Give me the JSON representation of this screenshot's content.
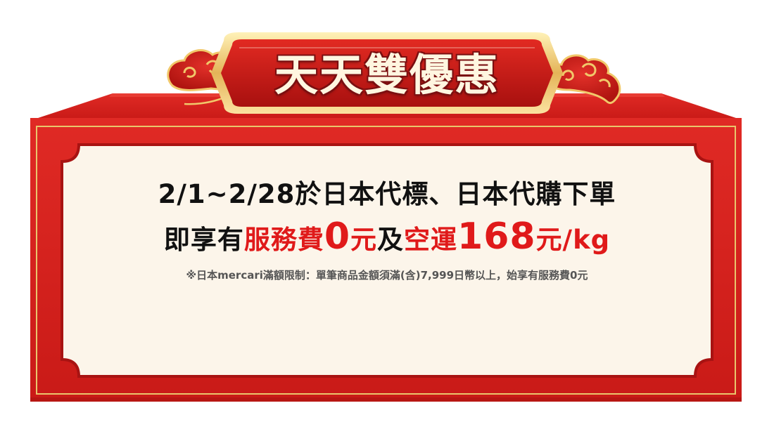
{
  "title": "天天雙優惠",
  "promo": {
    "line1": "2/1~2/28於日本代標、日本代購下單",
    "line2_prefix": "即享有",
    "line2_fee_label": "服務費",
    "line2_fee_amount": "0",
    "line2_fee_unit": "元",
    "line2_middle": "及",
    "line2_shipping_label": "空運",
    "line2_shipping_amount": "168",
    "line2_shipping_unit": "元/kg",
    "note": "※日本mercari滿額限制：單筆商品金額須滿(含)7,999日幣以上，始享有服務費0元"
  },
  "colors": {
    "frame_red": "#d4201e",
    "accent_red": "#e01a1a",
    "gold": "#e9c66c",
    "panel": "#fcf5ea"
  }
}
